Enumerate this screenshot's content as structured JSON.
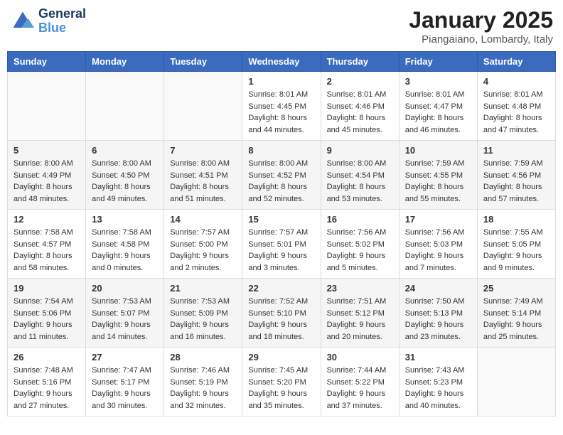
{
  "header": {
    "logo_line1": "General",
    "logo_line2": "Blue",
    "month": "January 2025",
    "location": "Piangaiano, Lombardy, Italy"
  },
  "weekdays": [
    "Sunday",
    "Monday",
    "Tuesday",
    "Wednesday",
    "Thursday",
    "Friday",
    "Saturday"
  ],
  "weeks": [
    [
      {
        "day": "",
        "info": ""
      },
      {
        "day": "",
        "info": ""
      },
      {
        "day": "",
        "info": ""
      },
      {
        "day": "1",
        "info": "Sunrise: 8:01 AM\nSunset: 4:45 PM\nDaylight: 8 hours\nand 44 minutes."
      },
      {
        "day": "2",
        "info": "Sunrise: 8:01 AM\nSunset: 4:46 PM\nDaylight: 8 hours\nand 45 minutes."
      },
      {
        "day": "3",
        "info": "Sunrise: 8:01 AM\nSunset: 4:47 PM\nDaylight: 8 hours\nand 46 minutes."
      },
      {
        "day": "4",
        "info": "Sunrise: 8:01 AM\nSunset: 4:48 PM\nDaylight: 8 hours\nand 47 minutes."
      }
    ],
    [
      {
        "day": "5",
        "info": "Sunrise: 8:00 AM\nSunset: 4:49 PM\nDaylight: 8 hours\nand 48 minutes."
      },
      {
        "day": "6",
        "info": "Sunrise: 8:00 AM\nSunset: 4:50 PM\nDaylight: 8 hours\nand 49 minutes."
      },
      {
        "day": "7",
        "info": "Sunrise: 8:00 AM\nSunset: 4:51 PM\nDaylight: 8 hours\nand 51 minutes."
      },
      {
        "day": "8",
        "info": "Sunrise: 8:00 AM\nSunset: 4:52 PM\nDaylight: 8 hours\nand 52 minutes."
      },
      {
        "day": "9",
        "info": "Sunrise: 8:00 AM\nSunset: 4:54 PM\nDaylight: 8 hours\nand 53 minutes."
      },
      {
        "day": "10",
        "info": "Sunrise: 7:59 AM\nSunset: 4:55 PM\nDaylight: 8 hours\nand 55 minutes."
      },
      {
        "day": "11",
        "info": "Sunrise: 7:59 AM\nSunset: 4:56 PM\nDaylight: 8 hours\nand 57 minutes."
      }
    ],
    [
      {
        "day": "12",
        "info": "Sunrise: 7:58 AM\nSunset: 4:57 PM\nDaylight: 8 hours\nand 58 minutes."
      },
      {
        "day": "13",
        "info": "Sunrise: 7:58 AM\nSunset: 4:58 PM\nDaylight: 9 hours\nand 0 minutes."
      },
      {
        "day": "14",
        "info": "Sunrise: 7:57 AM\nSunset: 5:00 PM\nDaylight: 9 hours\nand 2 minutes."
      },
      {
        "day": "15",
        "info": "Sunrise: 7:57 AM\nSunset: 5:01 PM\nDaylight: 9 hours\nand 3 minutes."
      },
      {
        "day": "16",
        "info": "Sunrise: 7:56 AM\nSunset: 5:02 PM\nDaylight: 9 hours\nand 5 minutes."
      },
      {
        "day": "17",
        "info": "Sunrise: 7:56 AM\nSunset: 5:03 PM\nDaylight: 9 hours\nand 7 minutes."
      },
      {
        "day": "18",
        "info": "Sunrise: 7:55 AM\nSunset: 5:05 PM\nDaylight: 9 hours\nand 9 minutes."
      }
    ],
    [
      {
        "day": "19",
        "info": "Sunrise: 7:54 AM\nSunset: 5:06 PM\nDaylight: 9 hours\nand 11 minutes."
      },
      {
        "day": "20",
        "info": "Sunrise: 7:53 AM\nSunset: 5:07 PM\nDaylight: 9 hours\nand 14 minutes."
      },
      {
        "day": "21",
        "info": "Sunrise: 7:53 AM\nSunset: 5:09 PM\nDaylight: 9 hours\nand 16 minutes."
      },
      {
        "day": "22",
        "info": "Sunrise: 7:52 AM\nSunset: 5:10 PM\nDaylight: 9 hours\nand 18 minutes."
      },
      {
        "day": "23",
        "info": "Sunrise: 7:51 AM\nSunset: 5:12 PM\nDaylight: 9 hours\nand 20 minutes."
      },
      {
        "day": "24",
        "info": "Sunrise: 7:50 AM\nSunset: 5:13 PM\nDaylight: 9 hours\nand 23 minutes."
      },
      {
        "day": "25",
        "info": "Sunrise: 7:49 AM\nSunset: 5:14 PM\nDaylight: 9 hours\nand 25 minutes."
      }
    ],
    [
      {
        "day": "26",
        "info": "Sunrise: 7:48 AM\nSunset: 5:16 PM\nDaylight: 9 hours\nand 27 minutes."
      },
      {
        "day": "27",
        "info": "Sunrise: 7:47 AM\nSunset: 5:17 PM\nDaylight: 9 hours\nand 30 minutes."
      },
      {
        "day": "28",
        "info": "Sunrise: 7:46 AM\nSunset: 5:19 PM\nDaylight: 9 hours\nand 32 minutes."
      },
      {
        "day": "29",
        "info": "Sunrise: 7:45 AM\nSunset: 5:20 PM\nDaylight: 9 hours\nand 35 minutes."
      },
      {
        "day": "30",
        "info": "Sunrise: 7:44 AM\nSunset: 5:22 PM\nDaylight: 9 hours\nand 37 minutes."
      },
      {
        "day": "31",
        "info": "Sunrise: 7:43 AM\nSunset: 5:23 PM\nDaylight: 9 hours\nand 40 minutes."
      },
      {
        "day": "",
        "info": ""
      }
    ]
  ]
}
